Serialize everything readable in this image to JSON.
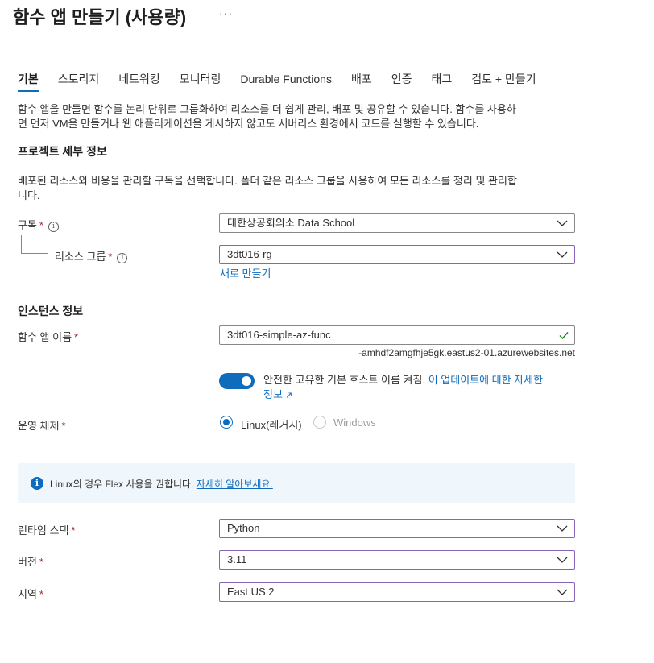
{
  "header": {
    "title": "함수 앱 만들기 (사용량)",
    "more": "···"
  },
  "tabs": [
    {
      "label": "기본"
    },
    {
      "label": "스토리지"
    },
    {
      "label": "네트워킹"
    },
    {
      "label": "모니터링"
    },
    {
      "label": "Durable Functions"
    },
    {
      "label": "배포"
    },
    {
      "label": "인증"
    },
    {
      "label": "태그"
    },
    {
      "label": "검토 + 만들기"
    }
  ],
  "intro": {
    "line1": "함수 앱을 만들면 함수를 논리 단위로 그룹화하여 리소스를 더 쉽게 관리, 배포 및 공유할 수 있습니다. 함수를 사용하",
    "line2": "면 먼저 VM을 만들거나 웹 애플리케이션을 게시하지 않고도 서버리스 환경에서 코드를 실행할 수 있습니다."
  },
  "project": {
    "heading": "프로젝트 세부 정보",
    "desc1": "배포된 리소스와 비용을 관리할 구독을 선택합니다. 폴더 같은 리소스 그룹을 사용하여 모든 리소스를 정리 및 관리합",
    "desc2": "니다.",
    "subscription_label": "구독",
    "subscription_value": "대한상공회의소 Data School",
    "rg_label": "리소스 그룹",
    "rg_value": "3dt016-rg",
    "create_new": "새로 만들기"
  },
  "instance": {
    "heading": "인스턴스 정보",
    "name_label": "함수 앱 이름",
    "name_value": "3dt016-simple-az-func",
    "domain_suffix": "-amhdf2amgfhje5gk.eastus2-01.azurewebsites.net",
    "toggle_text": "안전한 고유한 기본 호스트 이름 켜짐.",
    "toggle_link_1": "이 업데이트에 대한 자세한",
    "toggle_link_2": "정보",
    "toggle_on": true,
    "os_label": "운영 체제",
    "os_linux": "Linux(레거시)",
    "os_windows": "Windows",
    "os_selected": "Linux(레거시)"
  },
  "banner": {
    "text": "Linux의 경우 Flex 사용을 권합니다.",
    "link": "자세히 알아보세요."
  },
  "runtime": {
    "stack_label": "런타임 스택",
    "stack_value": "Python",
    "version_label": "버전",
    "version_value": "3.11",
    "region_label": "지역",
    "region_value": "East US 2"
  },
  "required_mark": "*",
  "colors": {
    "accent": "#0f6cbd",
    "required": "#a4262c",
    "success": "#107c10",
    "focus_border": "#8764b8"
  }
}
